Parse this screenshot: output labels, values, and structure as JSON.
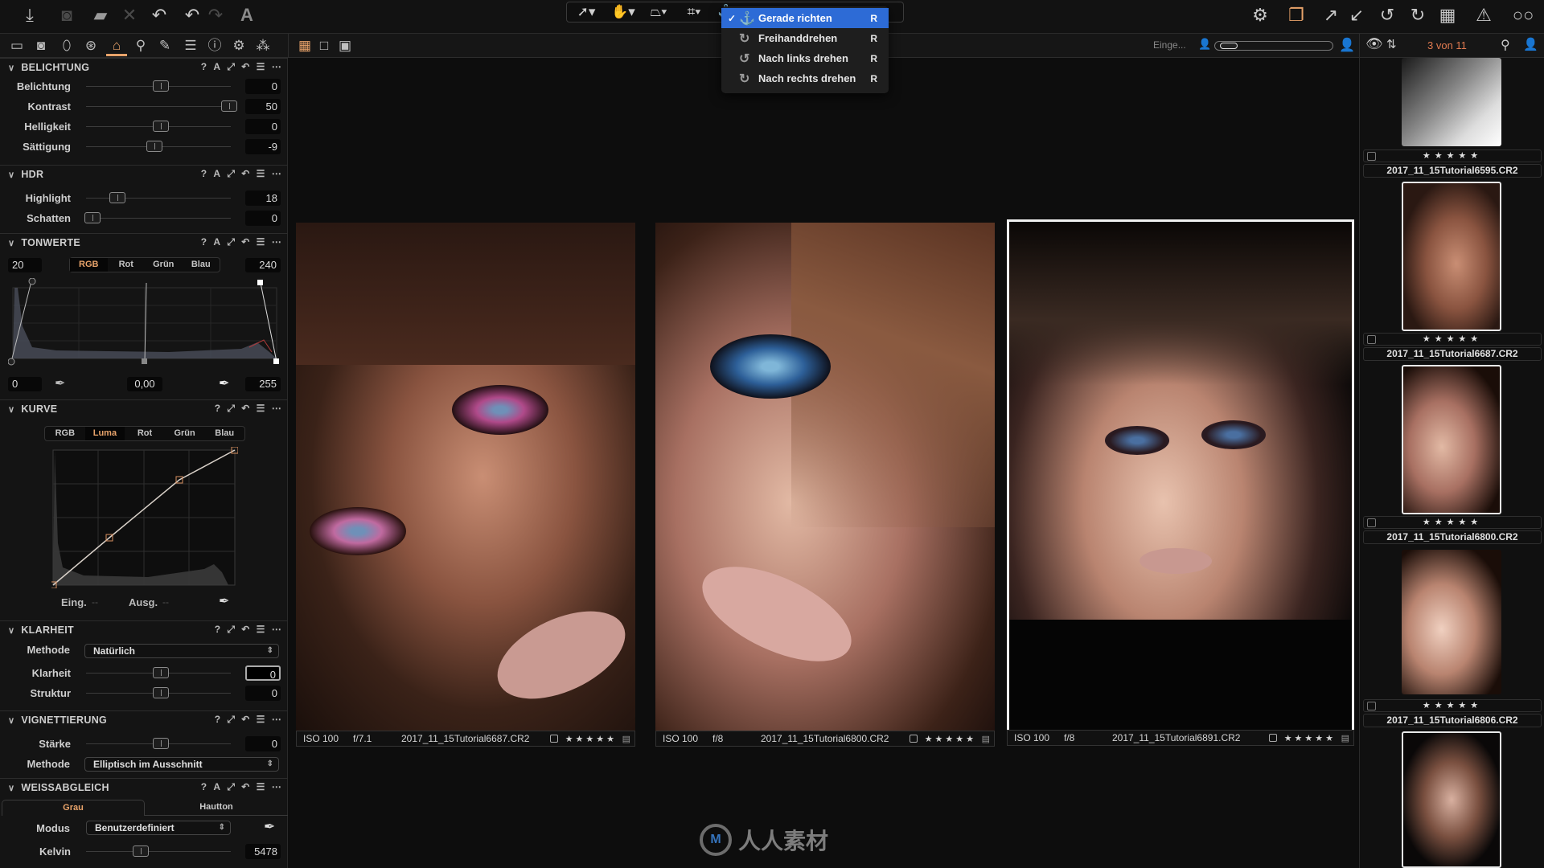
{
  "toolbar": {
    "left_icons": [
      "import-icon",
      "capture-icon",
      "export-icon",
      "delete-icon",
      "undo-all-icon",
      "undo-icon",
      "redo-icon",
      "text-icon"
    ],
    "cursor_tools": [
      "select-tool",
      "pan-tool",
      "keystone-tool",
      "crop-tool",
      "rotate-tool"
    ],
    "right_icons": [
      "settings-icon",
      "stack-icon",
      "expand-icon",
      "collapse-icon",
      "rotate-left-icon",
      "rotate-right-icon",
      "grid-icon",
      "warning-icon",
      "proof-glasses-icon"
    ]
  },
  "rotate_menu": {
    "items": [
      {
        "label": "Gerade richten",
        "shortcut": "R",
        "selected": true,
        "icon": "straighten-icon"
      },
      {
        "label": "Freihanddrehen",
        "shortcut": "R",
        "selected": false,
        "icon": "freehand-rotate-icon"
      },
      {
        "label": "Nach links drehen",
        "shortcut": "R",
        "selected": false,
        "icon": "rotate-left-icon"
      },
      {
        "label": "Nach rechts drehen",
        "shortcut": "R",
        "selected": false,
        "icon": "rotate-right-icon"
      }
    ]
  },
  "secondbar": {
    "rating_label": "Einge...",
    "count": "3 von 11",
    "accent": "#e8a36a"
  },
  "panels": {
    "belichtung": {
      "title": "BELICHTUNG",
      "sliders": [
        {
          "label": "Belichtung",
          "value": "0",
          "pos": 0.5
        },
        {
          "label": "Kontrast",
          "value": "50",
          "pos": 1.0
        },
        {
          "label": "Helligkeit",
          "value": "0",
          "pos": 0.5
        },
        {
          "label": "Sättigung",
          "value": "-9",
          "pos": 0.45
        }
      ]
    },
    "hdr": {
      "title": "HDR",
      "sliders": [
        {
          "label": "Highlight",
          "value": "18",
          "pos": 0.18
        },
        {
          "label": "Schatten",
          "value": "0",
          "pos": 0.0
        }
      ]
    },
    "tonwerte": {
      "title": "TONWERTE",
      "input_low": "20",
      "input_high": "240",
      "channels": [
        "RGB",
        "Rot",
        "Grün",
        "Blau"
      ],
      "active_channel": "RGB",
      "output_low": "0",
      "midpoint": "0,00",
      "output_high": "255"
    },
    "kurve": {
      "title": "KURVE",
      "channels": [
        "RGB",
        "Luma",
        "Rot",
        "Grün",
        "Blau"
      ],
      "active_channel": "Luma",
      "input_label": "Eing.",
      "output_label": "Ausg.",
      "input_value": "--",
      "output_value": "--"
    },
    "klarheit": {
      "title": "KLARHEIT",
      "method_label": "Methode",
      "method_value": "Natürlich",
      "sliders": [
        {
          "label": "Klarheit",
          "value": "0",
          "pos": 0.5
        },
        {
          "label": "Struktur",
          "value": "0",
          "pos": 0.5
        }
      ]
    },
    "vignettierung": {
      "title": "VIGNETTIERUNG",
      "sliders": [
        {
          "label": "Stärke",
          "value": "0",
          "pos": 0.5
        }
      ],
      "method_label": "Methode",
      "method_value": "Elliptisch im Ausschnitt"
    },
    "weissabgleich": {
      "title": "WEISSABGLEICH",
      "tabs": [
        "Grau",
        "Hautton"
      ],
      "active_tab": "Grau",
      "mode_label": "Modus",
      "mode_value": "Benutzerdefiniert",
      "kelvin_label": "Kelvin",
      "kelvin_value": "5478",
      "kelvin_pos": 0.35
    }
  },
  "viewer": {
    "photos": [
      {
        "iso": "ISO 100",
        "aperture": "f/7.1",
        "filename": "2017_11_15Tutorial6687.CR2",
        "stars": "★★★★★",
        "selected": false
      },
      {
        "iso": "ISO 100",
        "aperture": "f/8",
        "filename": "2017_11_15Tutorial6800.CR2",
        "stars": "★★★★★",
        "selected": false
      },
      {
        "iso": "ISO 100",
        "aperture": "f/8",
        "filename": "2017_11_15Tutorial6891.CR2",
        "stars": "★★★★★",
        "selected": true
      }
    ]
  },
  "filmstrip": {
    "items": [
      {
        "filename": "2017_11_15Tutorial6595.CR2",
        "stars": "★★★★★"
      },
      {
        "filename": "2017_11_15Tutorial6687.CR2",
        "stars": "★★★★★"
      },
      {
        "filename": "2017_11_15Tutorial6800.CR2",
        "stars": "★★★★★"
      },
      {
        "filename": "2017_11_15Tutorial6806.CR2",
        "stars": "★★★★★"
      }
    ]
  },
  "watermark": {
    "text": "人人素材"
  }
}
